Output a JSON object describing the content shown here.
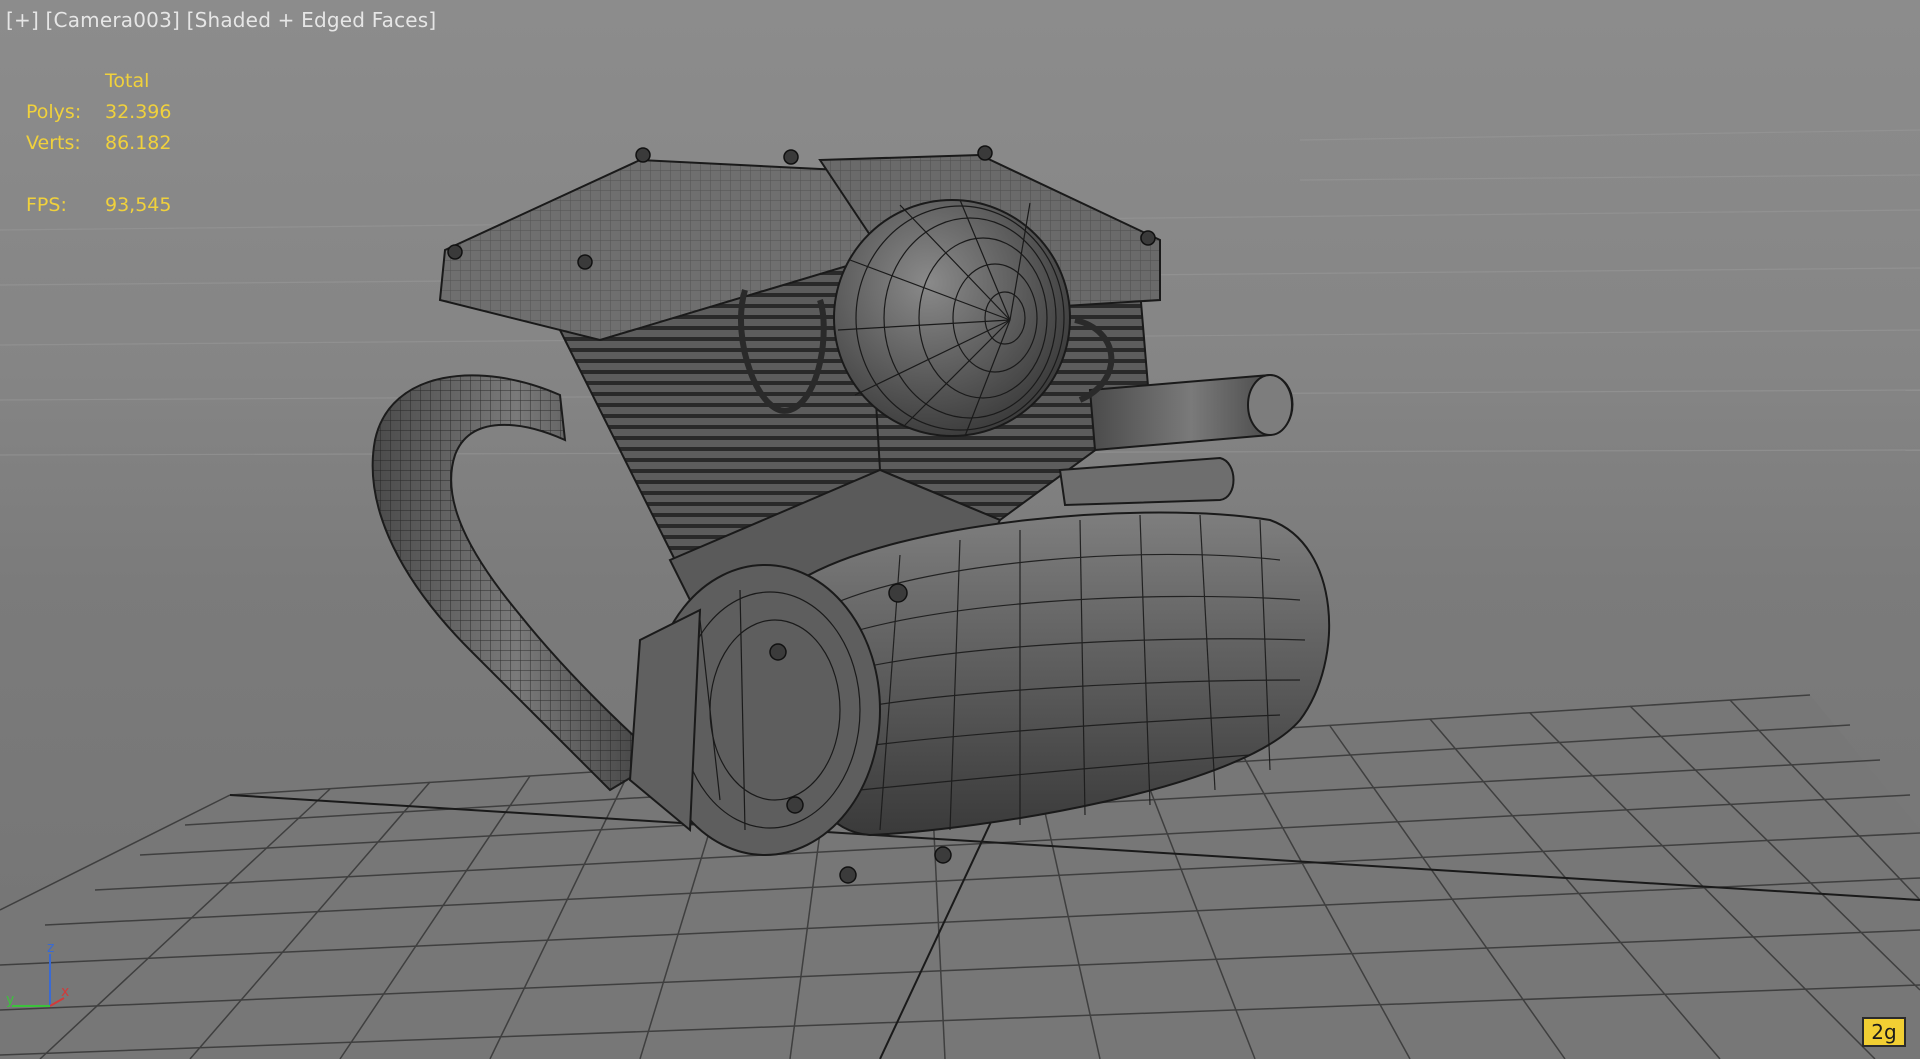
{
  "viewport": {
    "menu_plus": "[+]",
    "menu_camera": "[Camera003]",
    "menu_shading": "[Shaded + Edged Faces]"
  },
  "stats": {
    "header": "Total",
    "polys_label": "Polys:",
    "polys_value": "32.396",
    "verts_label": "Verts:",
    "verts_value": "86.182",
    "fps_label": "FPS:",
    "fps_value": "93,545"
  },
  "axis": {
    "z_label": "z",
    "x_label": "x",
    "y_label": "y"
  },
  "badge": {
    "label": "2g"
  },
  "colors": {
    "stats_text": "#f0d13c",
    "menu_text": "#e6e6e6",
    "badge_bg": "#f2cf33",
    "axis_x": "#d23a3a",
    "axis_y": "#3cc23c",
    "axis_z": "#3a6ad2"
  }
}
